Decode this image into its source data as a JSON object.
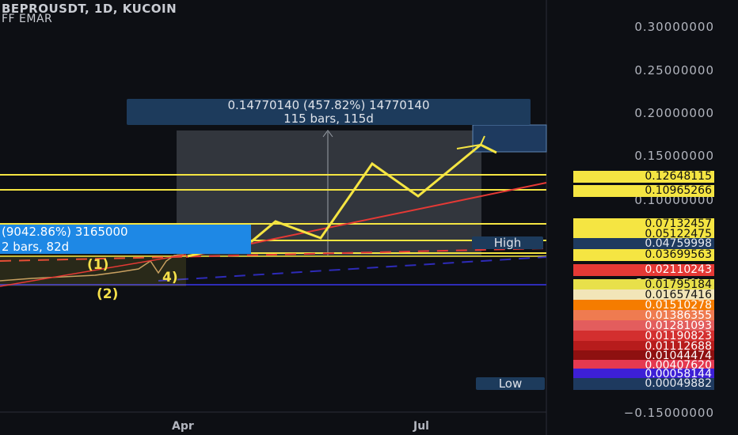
{
  "header": {
    "title": "BEPROUSDT, 1D, KUCOIN",
    "indicator": "FF EMAR"
  },
  "measure_top": {
    "line1": "0.14770140 (457.82%) 14770140",
    "line2": "115 bars, 115d"
  },
  "measure_left": {
    "line1": "(9042.86%) 3165000",
    "line2": "2 bars, 82d"
  },
  "overlay_pct": "3213.15%",
  "markers": {
    "high": "High",
    "low": "Low"
  },
  "wave_labels": [
    "(1)",
    "(2)",
    "4)"
  ],
  "x_axis": {
    "ticks": [
      "Apr",
      "Jul"
    ]
  },
  "y_axis": {
    "ticks": [
      "0.30000000",
      "0.25000000",
      "0.20000000",
      "0.15000000",
      "0.10000000",
      "−0.15000000"
    ]
  },
  "price_tags": [
    {
      "value": "0.12648115",
      "bg": "#f5e542",
      "fg": "#111111"
    },
    {
      "value": "0.10965266",
      "bg": "#f5e542",
      "fg": "#111111"
    },
    {
      "value": "0.07132457",
      "bg": "#f5e542",
      "fg": "#111111"
    },
    {
      "value": "0.05122475",
      "bg": "#f5e542",
      "fg": "#111111"
    },
    {
      "value": "0.04759998",
      "bg": "#1e3a5f",
      "fg": "#e6e9ef"
    },
    {
      "value": "0.03699563",
      "bg": "#f5e542",
      "fg": "#111111"
    },
    {
      "value": "0.02110243",
      "bg": "#e53935",
      "fg": "#ffffff"
    },
    {
      "value": "0.01795184",
      "bg": "#e8e04a",
      "fg": "#111111"
    },
    {
      "value": "0.01657416",
      "bg": "#f2e5b8",
      "fg": "#111111"
    },
    {
      "value": "0.01510278",
      "bg": "#f57c00",
      "fg": "#ffffff"
    },
    {
      "value": "0.01386355",
      "bg": "#ef7b50",
      "fg": "#ffffff"
    },
    {
      "value": "0.01281093",
      "bg": "#e35d5d",
      "fg": "#ffffff"
    },
    {
      "value": "0.01190823",
      "bg": "#d32f2f",
      "fg": "#ffffff"
    },
    {
      "value": "0.01112688",
      "bg": "#b71c1c",
      "fg": "#ffffff"
    },
    {
      "value": "0.01044474",
      "bg": "#8e1010",
      "fg": "#ffffff"
    },
    {
      "value": "0.00407620",
      "bg": "#e53950",
      "fg": "#ffffff"
    },
    {
      "value": "0.00058144",
      "bg": "#3d1fd6",
      "fg": "#ffffff"
    },
    {
      "value": "0.00049882",
      "bg": "#1e3a5f",
      "fg": "#e6e9ef"
    }
  ],
  "colors": {
    "yellow": "#f5e542",
    "red": "#e53935",
    "blue": "#2e2bb8",
    "panel": "#1e3a5f"
  }
}
